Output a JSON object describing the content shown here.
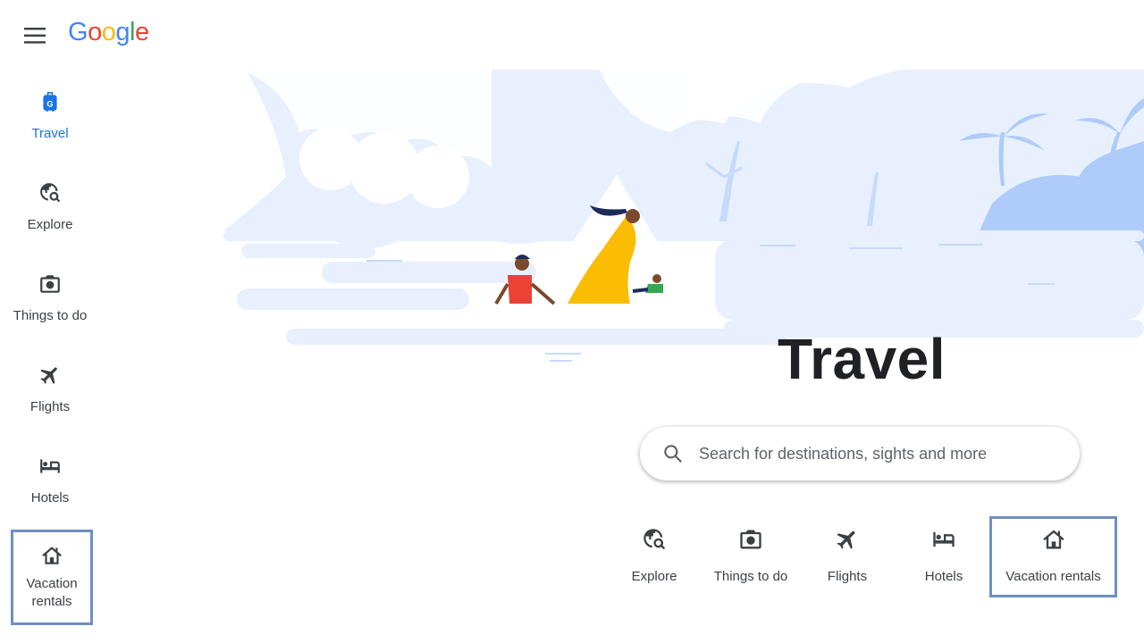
{
  "header": {
    "menu_icon": "hamburger-menu-icon",
    "logo_letters": [
      {
        "ch": "G",
        "color": "#4285F4"
      },
      {
        "ch": "o",
        "color": "#EA4335"
      },
      {
        "ch": "o",
        "color": "#FBBC05"
      },
      {
        "ch": "g",
        "color": "#4285F4"
      },
      {
        "ch": "l",
        "color": "#34A853"
      },
      {
        "ch": "e",
        "color": "#EA4335"
      }
    ]
  },
  "sidebar": {
    "items": [
      {
        "label": "Travel",
        "icon": "travel-suitcase-icon",
        "active": true
      },
      {
        "label": "Explore",
        "icon": "explore-globe-search-icon"
      },
      {
        "label": "Things to do",
        "icon": "camera-icon"
      },
      {
        "label": "Flights",
        "icon": "airplane-icon"
      },
      {
        "label": "Hotels",
        "icon": "bed-icon"
      },
      {
        "label": "Vacation rentals",
        "label_line1": "Vacation",
        "label_line2": "rentals",
        "icon": "house-icon"
      }
    ]
  },
  "main": {
    "title": "Travel",
    "search": {
      "placeholder": "Search for destinations, sights and more",
      "value": ""
    },
    "categories": [
      {
        "label": "Explore",
        "icon": "explore-globe-search-icon"
      },
      {
        "label": "Things to do",
        "icon": "camera-icon"
      },
      {
        "label": "Flights",
        "icon": "airplane-icon"
      },
      {
        "label": "Hotels",
        "icon": "bed-icon"
      },
      {
        "label": "Vacation rentals",
        "icon": "house-icon"
      }
    ]
  },
  "colors": {
    "accent": "#1a73e8",
    "highlight_border": "#6f8fc1",
    "illustration_light": "#e8f0fe",
    "illustration_mid": "#aecbfa"
  }
}
